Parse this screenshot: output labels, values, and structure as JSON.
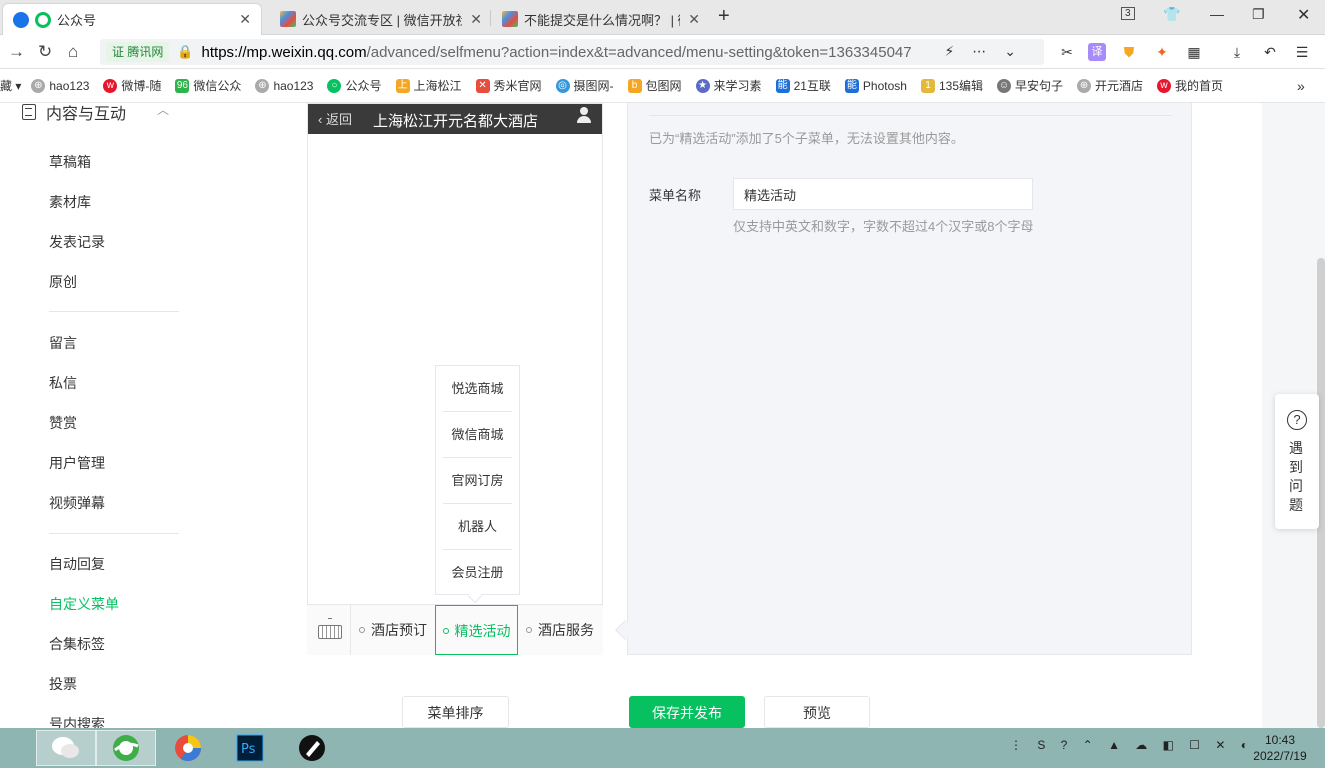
{
  "browser": {
    "tabs": [
      {
        "title": "公众号",
        "active": true
      },
      {
        "title": "公众号交流专区 | 微信开放社区"
      },
      {
        "title": "不能提交是什么情况啊？ | 微信"
      }
    ],
    "tab_count_badge": "3",
    "url_cert": "证 腾讯网",
    "url_host": "https://mp.weixin.qq.com",
    "url_path": "/advanced/selfmenu?action=index&t=advanced/menu-setting&token=1363345047",
    "bookmarks": [
      "藏",
      "hao123",
      "微博-随",
      "微信公众",
      "hao123",
      "公众号",
      "上海松江",
      "秀米官网",
      "摄图网-",
      "包图网",
      "来学习素",
      "21互联",
      "Photosh",
      "135编辑",
      "早安句子",
      "开元酒店",
      "我的首页"
    ]
  },
  "sidebar": {
    "section_title": "内容与互动",
    "group1": [
      "草稿箱",
      "素材库",
      "发表记录",
      "原创"
    ],
    "group2": [
      "留言",
      "私信",
      "赞赏",
      "用户管理",
      "视频弹幕"
    ],
    "group3": [
      "自动回复",
      "自定义菜单",
      "合集标签",
      "投票",
      "号内搜索"
    ],
    "active_item": "自定义菜单"
  },
  "phone": {
    "back_label": "返回",
    "account_name": "上海松江开元名都大酒店",
    "submenu": [
      "悦选商城",
      "微信商城",
      "官网订房",
      "机器人",
      "会员注册"
    ],
    "menus": [
      "酒店预订",
      "精选活动",
      "酒店服务"
    ],
    "selected_menu": "精选活动"
  },
  "editor": {
    "notice": "已为“精选活动”添加了5个子菜单，无法设置其他内容。",
    "name_label": "菜单名称",
    "name_value": "精选活动",
    "name_tip": "仅支持中英文和数字，字数不超过4个汉字或8个字母"
  },
  "actions": {
    "sort": "菜单排序",
    "publish": "保存并发布",
    "preview": "预览"
  },
  "help": {
    "text": "遇到问题"
  },
  "taskbar": {
    "time": "10:43",
    "date": "2022/7/19"
  },
  "colors": {
    "brand_green": "#07c160",
    "phone_header": "#3a3a3a"
  }
}
